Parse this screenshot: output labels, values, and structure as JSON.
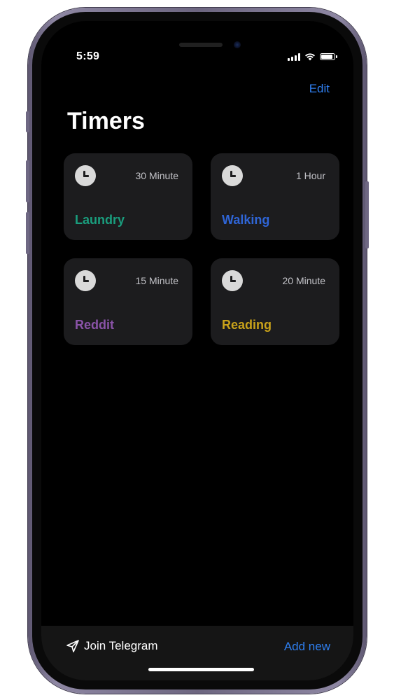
{
  "status_bar": {
    "time": "5:59"
  },
  "header": {
    "edit_label": "Edit",
    "title": "Timers"
  },
  "timers": [
    {
      "name": "Laundry",
      "duration": "30 Minute",
      "color": "#1a9e7e"
    },
    {
      "name": "Walking",
      "duration": "1 Hour",
      "color": "#2f65d6"
    },
    {
      "name": "Reddit",
      "duration": "15 Minute",
      "color": "#8a53a8"
    },
    {
      "name": "Reading",
      "duration": "20 Minute",
      "color": "#c9a21a"
    }
  ],
  "bottom_bar": {
    "telegram_label": "Join Telegram",
    "add_new_label": "Add new"
  },
  "colors": {
    "accent": "#2f7ff0",
    "background": "#000000",
    "card": "#1c1c1e"
  }
}
